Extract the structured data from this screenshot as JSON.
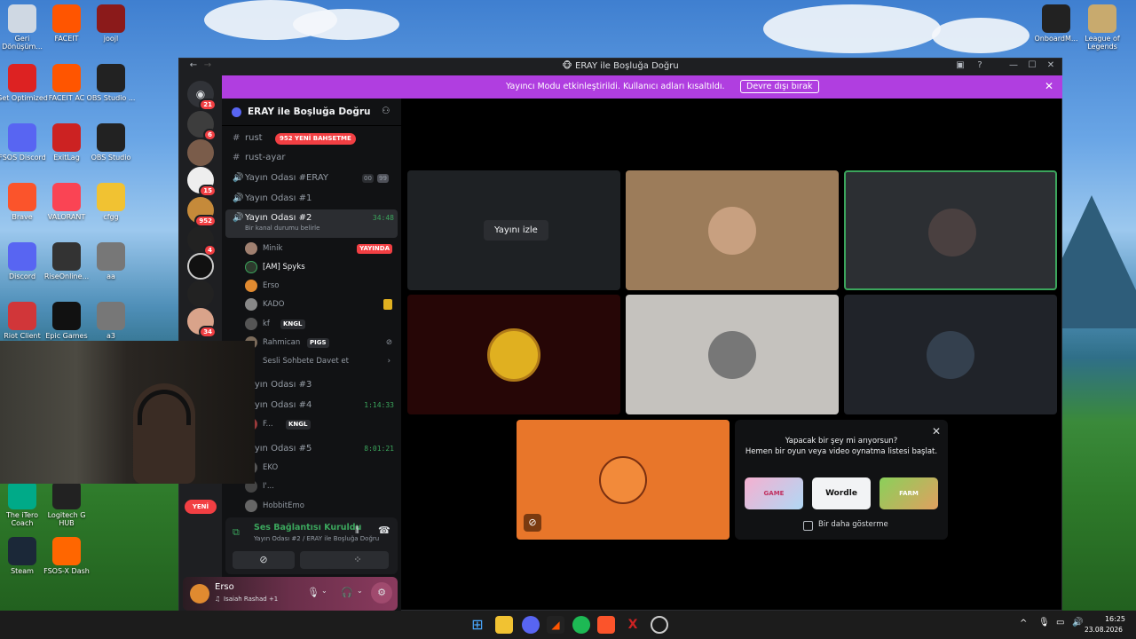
{
  "desktop_left": [
    {
      "label": "Geri Dönüşüm...",
      "icon": "recycle-bin-icon",
      "color": "#cfd8e3"
    },
    {
      "label": "FACEIT",
      "icon": "faceit-icon",
      "color": "#ff5500"
    },
    {
      "label": "joojl",
      "icon": "game-icon",
      "color": "#8b1a1a"
    },
    {
      "label": "Get Optimized",
      "icon": "app-icon",
      "color": "#d22"
    },
    {
      "label": "FACEIT AC",
      "icon": "faceit-ac-icon",
      "color": "#ff5500"
    },
    {
      "label": "OBS Studio ...",
      "icon": "obs-icon",
      "color": "#222"
    },
    {
      "label": "FSOS Discord",
      "icon": "discord-icon",
      "color": "#5865f2"
    },
    {
      "label": "ExitLag",
      "icon": "exitlag-icon",
      "color": "#c22"
    },
    {
      "label": "OBS Studio",
      "icon": "obs-icon",
      "color": "#222"
    },
    {
      "label": "Brave",
      "icon": "brave-icon",
      "color": "#fb542b"
    },
    {
      "label": "VALORANT",
      "icon": "valorant-icon",
      "color": "#fa4454"
    },
    {
      "label": "cfgg",
      "icon": "folder-icon",
      "color": "#f1c232"
    },
    {
      "label": "Discord",
      "icon": "discord-icon",
      "color": "#5865f2"
    },
    {
      "label": "RiseOnline...",
      "icon": "riseonline-icon",
      "color": "#333"
    },
    {
      "label": "aa",
      "icon": "image-icon",
      "color": "#777"
    },
    {
      "label": "Riot Client",
      "icon": "riot-icon",
      "color": "#d13639"
    },
    {
      "label": "Epic Games",
      "icon": "epic-icon",
      "color": "#111"
    },
    {
      "label": "a3",
      "icon": "image-icon",
      "color": "#777"
    }
  ],
  "desktop_right": [
    {
      "label": "OnboardM...",
      "icon": "logitech-icon",
      "color": "#222"
    },
    {
      "label": "League of Legends",
      "icon": "league-icon",
      "color": "#c8aa6e"
    }
  ],
  "desktop_bottom": [
    {
      "label": "The iTero Coach",
      "icon": "coach-icon",
      "color": "#0a8"
    },
    {
      "label": "Logitech G HUB",
      "icon": "logitech-icon",
      "color": "#222"
    },
    {
      "label": "Steam",
      "icon": "steam-icon",
      "color": "#1b2838"
    },
    {
      "label": "FSOS-X Dash",
      "icon": "dash-icon",
      "color": "#f60"
    }
  ],
  "window": {
    "title": "ERAY ile Boşluğa Doğru"
  },
  "banner": {
    "message": "Yayıncı Modu etkinleştirildi. Kullanıcı adları kısaltıldı.",
    "button": "Devre dışı bırak"
  },
  "rail_badges": [
    "21",
    "6",
    "15",
    "952",
    "4",
    "34",
    "YENİ"
  ],
  "server": {
    "name": "ERAY ile Boşluğa Doğru"
  },
  "channels": {
    "rust": "rust",
    "rust_badge": "952 YENİ BAHSETME",
    "rust_ayar": "rust-ayar",
    "yayin_eray": "Yayın Odası #ERAY",
    "eray_count_a": "00",
    "eray_count_b": "99",
    "yayin1": "Yayın Odası #1",
    "yayin2": "Yayın Odası #2",
    "yayin2_time": "34:48",
    "yayin2_status": "Bir kanal durumu belirle",
    "yayin3": "Yayın Odası #3",
    "yayin4": "Yayın Odası #4",
    "yayin4_time": "1:14:33",
    "yayin5": "Yayın Odası #5",
    "yayin5_time": "8:01:21",
    "invite": "Sesli Sohbete Davet et"
  },
  "members2": [
    {
      "name": "Minik",
      "tag": "YAYINDA"
    },
    {
      "name": "[AM] Spyks",
      "tag": ""
    },
    {
      "name": "Erso",
      "tag": ""
    },
    {
      "name": "KADO",
      "tag": ""
    },
    {
      "name": "kf",
      "tag": "KNGL"
    },
    {
      "name": "Rahmican",
      "tag": "PIGS"
    }
  ],
  "members4": [
    {
      "name": "F...",
      "tag": "KNGL"
    }
  ],
  "members5": [
    {
      "name": "EKO"
    },
    {
      "name": "I'..."
    },
    {
      "name": "HobbitEmo"
    }
  ],
  "voice": {
    "status": "Ses Bağlantısı Kuruldu",
    "detail": "Yayın Odası #2 / ERAY ile Boşluğa Doğru"
  },
  "user": {
    "name": "Erso",
    "activity": "Isaiah Rashad +1"
  },
  "stage": {
    "watch_button": "Yayını izle"
  },
  "activity": {
    "line1": "Yapacak bir şey mi arıyorsun?",
    "line2": "Hemen bir oyun veya video oynatma listesi başlat.",
    "option": "Bir daha gösterme",
    "games": [
      "GAME",
      "Wordle",
      "FARM"
    ]
  },
  "clock": {
    "time": "16:25",
    "date": "23.08.2026"
  },
  "colors": {
    "blurple": "#5865f2",
    "banner": "#b03ee0",
    "speaking": "#3ba55c",
    "danger": "#f23f43"
  }
}
